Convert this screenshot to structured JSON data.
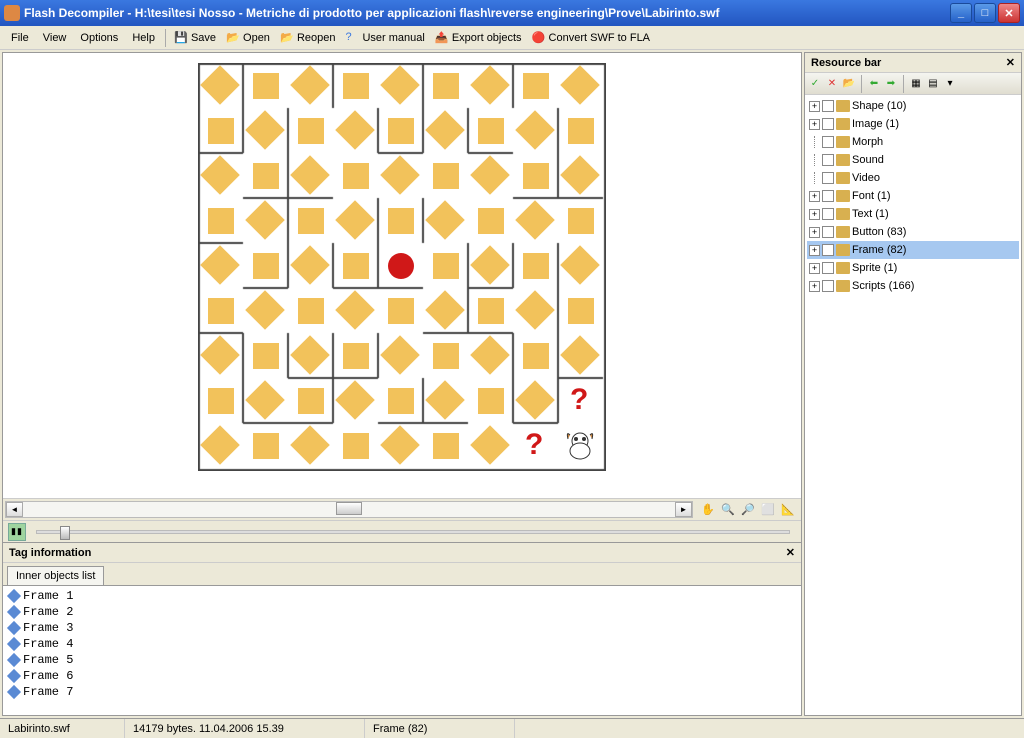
{
  "window_title": "Flash Decompiler  - H:\\tesi\\tesi Nosso - Metriche di prodotto per applicazioni flash\\reverse engineering\\Prove\\Labirinto.swf",
  "menu": {
    "file": "File",
    "view": "View",
    "options": "Options",
    "help": "Help"
  },
  "toolbar": {
    "save": "Save",
    "open": "Open",
    "reopen": "Reopen",
    "user_manual": "User manual",
    "export_objects": "Export objects",
    "convert": "Convert SWF to FLA"
  },
  "resource_bar": {
    "title": "Resource bar",
    "items": [
      {
        "label": "Shape (10)",
        "expandable": true,
        "color": "#d8b050"
      },
      {
        "label": "Image (1)",
        "expandable": true,
        "color": "#d8b050"
      },
      {
        "label": "Morph",
        "expandable": false,
        "color": "#d8b050"
      },
      {
        "label": "Sound",
        "expandable": false,
        "color": "#d8b050"
      },
      {
        "label": "Video",
        "expandable": false,
        "color": "#d8b050"
      },
      {
        "label": "Font (1)",
        "expandable": true,
        "color": "#d8b050"
      },
      {
        "label": "Text (1)",
        "expandable": true,
        "color": "#d8b050"
      },
      {
        "label": "Button (83)",
        "expandable": true,
        "color": "#d8b050"
      },
      {
        "label": "Frame (82)",
        "expandable": true,
        "selected": true,
        "color": "#d8b050"
      },
      {
        "label": "Sprite (1)",
        "expandable": true,
        "color": "#d8b050"
      },
      {
        "label": "Scripts (166)",
        "expandable": true,
        "color": "#d8b050"
      }
    ]
  },
  "tag_info": {
    "title": "Tag information",
    "tab": "Inner objects list",
    "frames": [
      "Frame 1",
      "Frame 2",
      "Frame 3",
      "Frame 4",
      "Frame 5",
      "Frame 6",
      "Frame 7"
    ]
  },
  "statusbar": {
    "file": "Labirinto.swf",
    "bytes": "14179 bytes. 11.04.2006 15.39",
    "frame": "Frame (82)"
  }
}
